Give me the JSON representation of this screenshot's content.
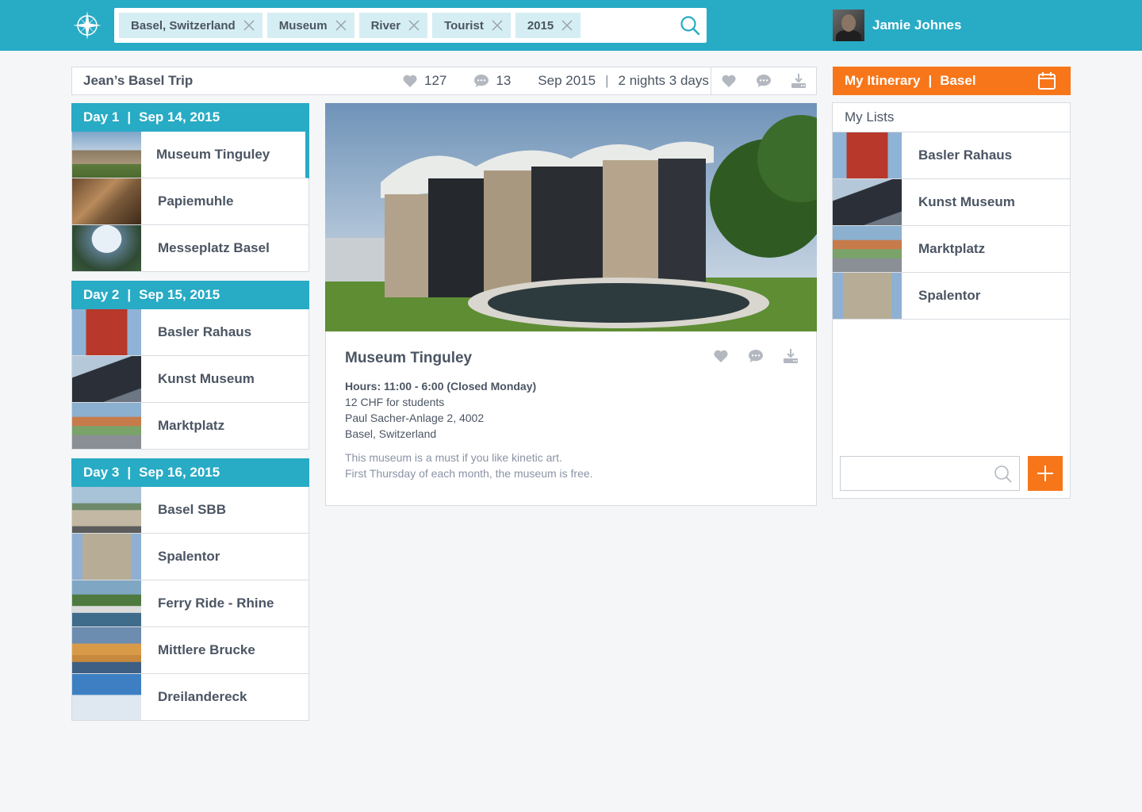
{
  "app": {
    "logo_icon": "compass-icon",
    "accent": "#28abc5",
    "orange": "#f7761a"
  },
  "search": {
    "chips": [
      "Basel, Switzerland",
      "Museum",
      "River",
      "Tourist",
      "2015"
    ]
  },
  "user": {
    "name": "Jamie Johnes"
  },
  "trip": {
    "title": "Jean’s Basel Trip",
    "likes": "127",
    "comments": "13",
    "date": "Sep 2015",
    "duration": "2 nights 3 days"
  },
  "days": [
    {
      "label": "Day 1",
      "date": "Sep 14, 2015",
      "places": [
        "Museum Tinguley",
        "Papiemuhle",
        "Messeplatz Basel"
      ]
    },
    {
      "label": "Day 2",
      "date": "Sep 15, 2015",
      "places": [
        "Basler Rahaus",
        "Kunst Museum",
        "Marktplatz"
      ]
    },
    {
      "label": "Day 3",
      "date": "Sep 16, 2015",
      "places": [
        "Basel SBB",
        "Spalentor",
        "Ferry Ride - Rhine",
        "Mittlere Brucke",
        "Dreilandereck"
      ]
    }
  ],
  "detail": {
    "title": "Museum Tinguley",
    "hours": "Hours: 11:00 - 6:00 (Closed Monday)",
    "price": "12 CHF for students",
    "address1": "Paul Sacher-Anlage 2, 4002",
    "address2": "Basel, Switzerland",
    "note1": "This museum is a must if you like kinetic art.",
    "note2": "First Thursday of each month, the museum is free."
  },
  "itinerary": {
    "label": "My Itinerary",
    "city": "Basel"
  },
  "lists": {
    "title": "My Lists",
    "places": [
      "Basler Rahaus",
      "Kunst Museum",
      "Marktplatz",
      "Spalentor"
    ],
    "search_placeholder": ""
  }
}
